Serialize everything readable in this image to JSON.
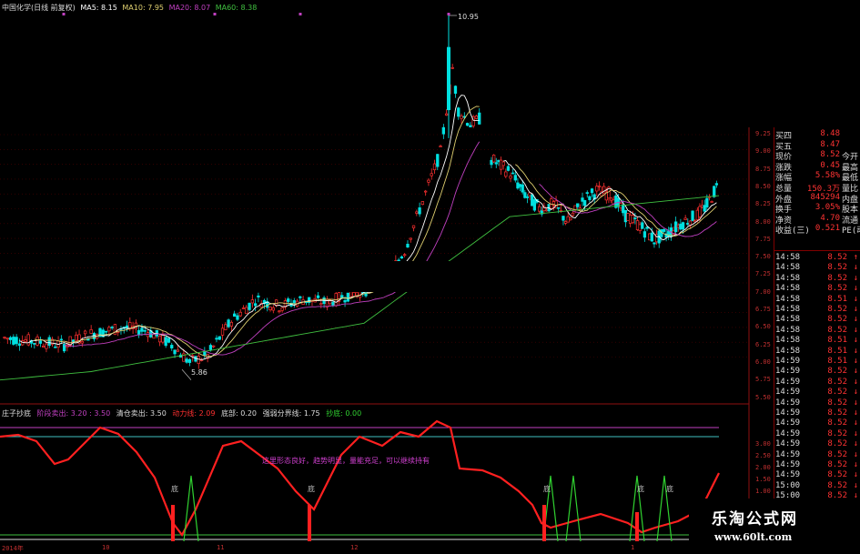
{
  "main_chart": {
    "title": "中国化学(日线 前复权)",
    "ma": [
      {
        "label": "MA5: 8.15",
        "color": "#ffffff"
      },
      {
        "label": "MA10: 7.95",
        "color": "#e0d070"
      },
      {
        "label": "MA20: 8.07",
        "color": "#c040c0"
      },
      {
        "label": "MA60: 8.38",
        "color": "#40c040"
      }
    ],
    "high_label": "10.95",
    "low_label": "5.86",
    "y_axis": [
      "9.25",
      "9.00",
      "8.75",
      "8.50",
      "8.25",
      "8.00",
      "7.75",
      "7.50",
      "7.25",
      "7.00",
      "6.75",
      "6.50",
      "6.25",
      "6.00",
      "5.75",
      "5.50"
    ]
  },
  "indicator": {
    "title": "庄子抄底",
    "params": [
      {
        "label": "阶段卖出: 3.20 : 3.50",
        "color": "#c040c0"
      },
      {
        "label": "清仓卖出: 3.50",
        "color": "#dddddd"
      },
      {
        "label": "动力线: 2.09",
        "color": "#ff3030"
      },
      {
        "label": "底部: 0.20",
        "color": "#dddddd"
      },
      {
        "label": "强弱分界线: 1.75",
        "color": "#dddddd"
      },
      {
        "label": "抄底: 0.00",
        "color": "#30d030"
      }
    ],
    "annotation": "这里形态良好，趋势明显，量能充足，可以继续持有",
    "signal_char": "底",
    "y_axis": [
      "3.00",
      "2.50",
      "2.00",
      "1.50",
      "1.00"
    ]
  },
  "dates": [
    "2014年",
    "10",
    "11",
    "12",
    "1"
  ],
  "quotes": [
    {
      "k": "买四",
      "v": "8.48",
      "x": ""
    },
    {
      "k": "买五",
      "v": "8.47",
      "x": ""
    },
    {
      "k": "现价",
      "v": "8.52",
      "x": "今开"
    },
    {
      "k": "涨跌",
      "v": "0.45",
      "x": "最高"
    },
    {
      "k": "涨幅",
      "v": "5.58%",
      "x": "最低"
    },
    {
      "k": "总量",
      "v": "150.3万",
      "x": "量比"
    },
    {
      "k": "外盘",
      "v": "845294",
      "x": "内盘"
    },
    {
      "k": "换手",
      "v": "3.05%",
      "x": "股本"
    },
    {
      "k": "净资",
      "v": "4.70",
      "x": "流通"
    },
    {
      "k": "收益(三)",
      "v": "0.521",
      "x": "PE(动"
    }
  ],
  "ticks": [
    {
      "t": "14:58",
      "p": "8.52",
      "d": "↑"
    },
    {
      "t": "14:58",
      "p": "8.52",
      "d": "↓"
    },
    {
      "t": "14:58",
      "p": "8.52",
      "d": "↓"
    },
    {
      "t": "14:58",
      "p": "8.52",
      "d": "↓"
    },
    {
      "t": "14:58",
      "p": "8.51",
      "d": "↓"
    },
    {
      "t": "14:58",
      "p": "8.52",
      "d": "↓"
    },
    {
      "t": "14:58",
      "p": "8.52",
      "d": "↓"
    },
    {
      "t": "14:58",
      "p": "8.52",
      "d": "↓"
    },
    {
      "t": "14:58",
      "p": "8.51",
      "d": "↓"
    },
    {
      "t": "14:58",
      "p": "8.51",
      "d": "↓"
    },
    {
      "t": "14:59",
      "p": "8.51",
      "d": "↓"
    },
    {
      "t": "14:59",
      "p": "8.52",
      "d": "↓"
    },
    {
      "t": "14:59",
      "p": "8.52",
      "d": "↓"
    },
    {
      "t": "14:59",
      "p": "8.52",
      "d": "↓"
    },
    {
      "t": "14:59",
      "p": "8.52",
      "d": "↓"
    },
    {
      "t": "14:59",
      "p": "8.52",
      "d": "↓"
    },
    {
      "t": "14:59",
      "p": "8.52",
      "d": "↓"
    },
    {
      "t": "14:59",
      "p": "8.52",
      "d": "↓"
    },
    {
      "t": "14:59",
      "p": "8.52",
      "d": "↓"
    },
    {
      "t": "14:59",
      "p": "8.52",
      "d": "↓"
    },
    {
      "t": "14:59",
      "p": "8.52",
      "d": "↓"
    },
    {
      "t": "14:59",
      "p": "8.52",
      "d": "↓"
    },
    {
      "t": "15:00",
      "p": "8.52",
      "d": "↓"
    },
    {
      "t": "15:00",
      "p": "8.52",
      "d": "↓"
    },
    {
      "t": "15:00",
      "p": "8.52",
      "d": "↓"
    }
  ],
  "watermark": {
    "title": "乐淘公式网",
    "url": "www.60lt.com"
  }
}
